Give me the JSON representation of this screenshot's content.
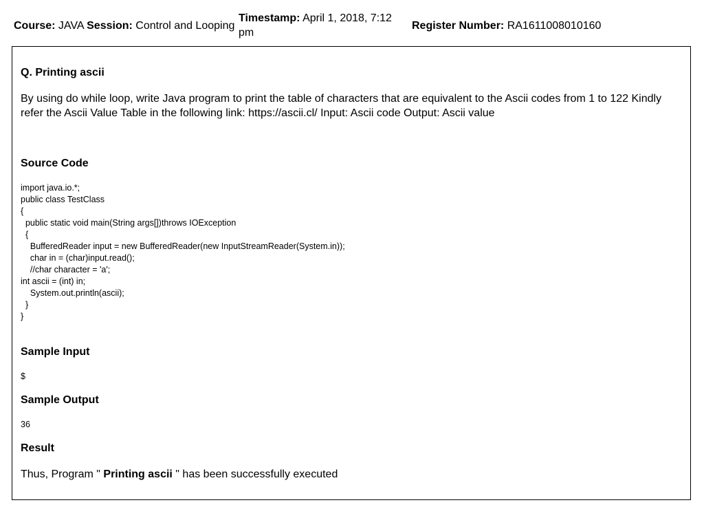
{
  "header": {
    "course_label": "Course:",
    "course_value": "JAVA",
    "session_label": "Session:",
    "session_value": "Control and Looping",
    "timestamp_label": "Timestamp:",
    "timestamp_value": "April 1, 2018, 7:12 pm",
    "register_label": "Register Number:",
    "register_value": "RA1611008010160"
  },
  "question": {
    "title": "Q. Printing ascii",
    "text": "By using do while loop, write Java program to print the table of characters that are equivalent to the Ascii codes from 1 to 122 Kindly refer the Ascii Value Table in the following link: https://ascii.cl/ Input: Ascii code Output: Ascii value"
  },
  "source_code": {
    "title": "Source Code",
    "code": "import java.io.*;\npublic class TestClass\n{\n  public static void main(String args[])throws IOException\n  {\n    BufferedReader input = new BufferedReader(new InputStreamReader(System.in));\n    char in = (char)input.read();\n    //char character = 'a';\nint ascii = (int) in;\n    System.out.println(ascii);\n  }\n}"
  },
  "sample_input": {
    "title": "Sample Input",
    "value": "$"
  },
  "sample_output": {
    "title": "Sample Output",
    "value": "36"
  },
  "result": {
    "title": "Result",
    "prefix": "Thus, Program \" ",
    "program_name": "Printing ascii",
    "suffix": " \" has been successfully executed"
  }
}
